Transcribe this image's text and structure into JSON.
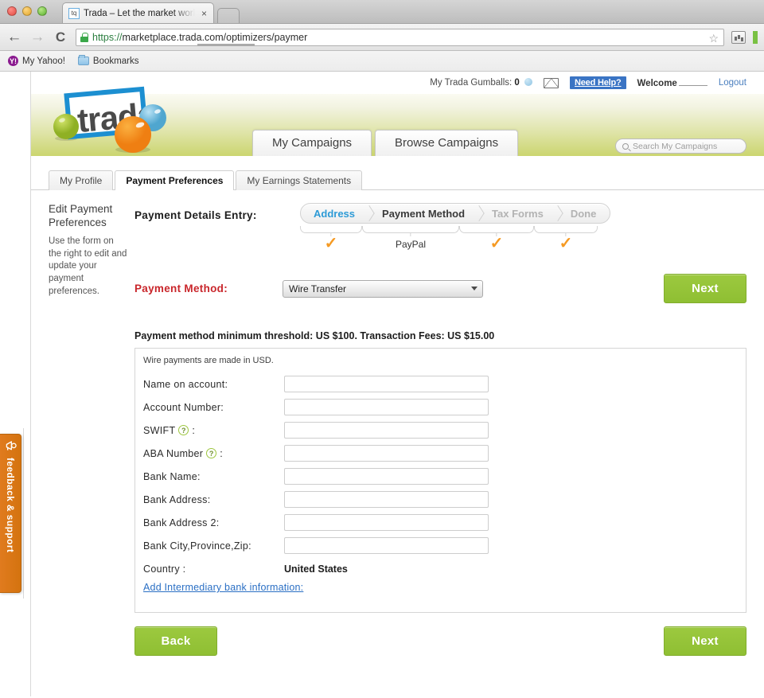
{
  "browser": {
    "tab_title": "Trada – Let the market work",
    "favicon_text": "tq",
    "close_label": "×",
    "back_label": "←",
    "forward_label": "→",
    "reload_label": "C",
    "url_scheme": "https://",
    "url_rest": "marketplace.trada.com/optimizers/paymer",
    "star_label": "☆",
    "bookmarks": [
      {
        "label": "My Yahoo!",
        "icon": "yahoo-icon",
        "glyph": "Y!"
      },
      {
        "label": "Bookmarks",
        "icon": "folder-icon",
        "glyph": ""
      }
    ]
  },
  "feedback": {
    "label": "feedback & support",
    "icon": "megaphone-icon"
  },
  "utilbar": {
    "gumballs_label": "My Trada Gumballs:",
    "gumballs_count": "0",
    "gumball_icon": "gumball-icon",
    "mail_icon": "envelope-icon",
    "need_help": "Need Help?",
    "welcome": "Welcome",
    "logout": "Logout"
  },
  "brand": {
    "logo_text": "trada"
  },
  "nav": {
    "tabs": [
      {
        "label": "My Campaigns"
      },
      {
        "label": "Browse Campaigns"
      }
    ],
    "search_placeholder": "Search My Campaigns",
    "search_value": "",
    "search_icon": "search-icon"
  },
  "subtabs": [
    {
      "label": "My Profile",
      "active": false
    },
    {
      "label": "Payment Preferences",
      "active": true
    },
    {
      "label": "My Earnings Statements",
      "active": false
    }
  ],
  "sidebar": {
    "title": "Edit Payment Preferences",
    "description": "Use the form on the right to edit and update your payment preferences."
  },
  "wizard": {
    "label": "Payment Details Entry:",
    "steps": [
      {
        "label": "Address",
        "state": "active",
        "value": "",
        "check": "✓"
      },
      {
        "label": "Payment Method",
        "state": "dark",
        "value": "PayPal",
        "check": ""
      },
      {
        "label": "Tax Forms",
        "state": "muted",
        "value": "",
        "check": "✓"
      },
      {
        "label": "Done",
        "state": "muted",
        "value": "",
        "check": "✓"
      }
    ]
  },
  "payment_method": {
    "label": "Payment Method:",
    "selected": "Wire Transfer",
    "next_label": "Next"
  },
  "threshold_text": "Payment method minimum threshold: US $100. Transaction Fees: US $15.00",
  "form": {
    "note": "Wire payments are made in USD.",
    "fields": [
      {
        "label": "Name on account:",
        "value": "",
        "type": "input",
        "help": false
      },
      {
        "label": "Account Number:",
        "value": "",
        "type": "input",
        "help": false
      },
      {
        "label": "SWIFT",
        "suffix": ":",
        "value": "",
        "type": "input",
        "help": true
      },
      {
        "label": "ABA Number",
        "suffix": ":",
        "value": "",
        "type": "input",
        "help": true
      },
      {
        "label": "Bank Name:",
        "value": "",
        "type": "input",
        "help": false
      },
      {
        "label": "Bank Address:",
        "value": "",
        "type": "input",
        "help": false
      },
      {
        "label": "Bank Address 2:",
        "value": "",
        "type": "input",
        "help": false
      },
      {
        "label": "Bank City,Province,Zip:",
        "value": "",
        "type": "input",
        "help": false
      },
      {
        "label": "Country :",
        "value": "United States",
        "type": "static",
        "help": false
      }
    ],
    "help_glyph": "?",
    "intermediary_link": "Add Intermediary bank information:"
  },
  "footer": {
    "back_label": "Back",
    "next_label": "Next"
  },
  "colors": {
    "green_button": "#9cc93f",
    "accent_red": "#c9262b",
    "link_blue": "#2a6fc4",
    "step_active": "#2e9bd6",
    "check_orange": "#f59a23",
    "feedback_orange": "#e07b1e"
  }
}
